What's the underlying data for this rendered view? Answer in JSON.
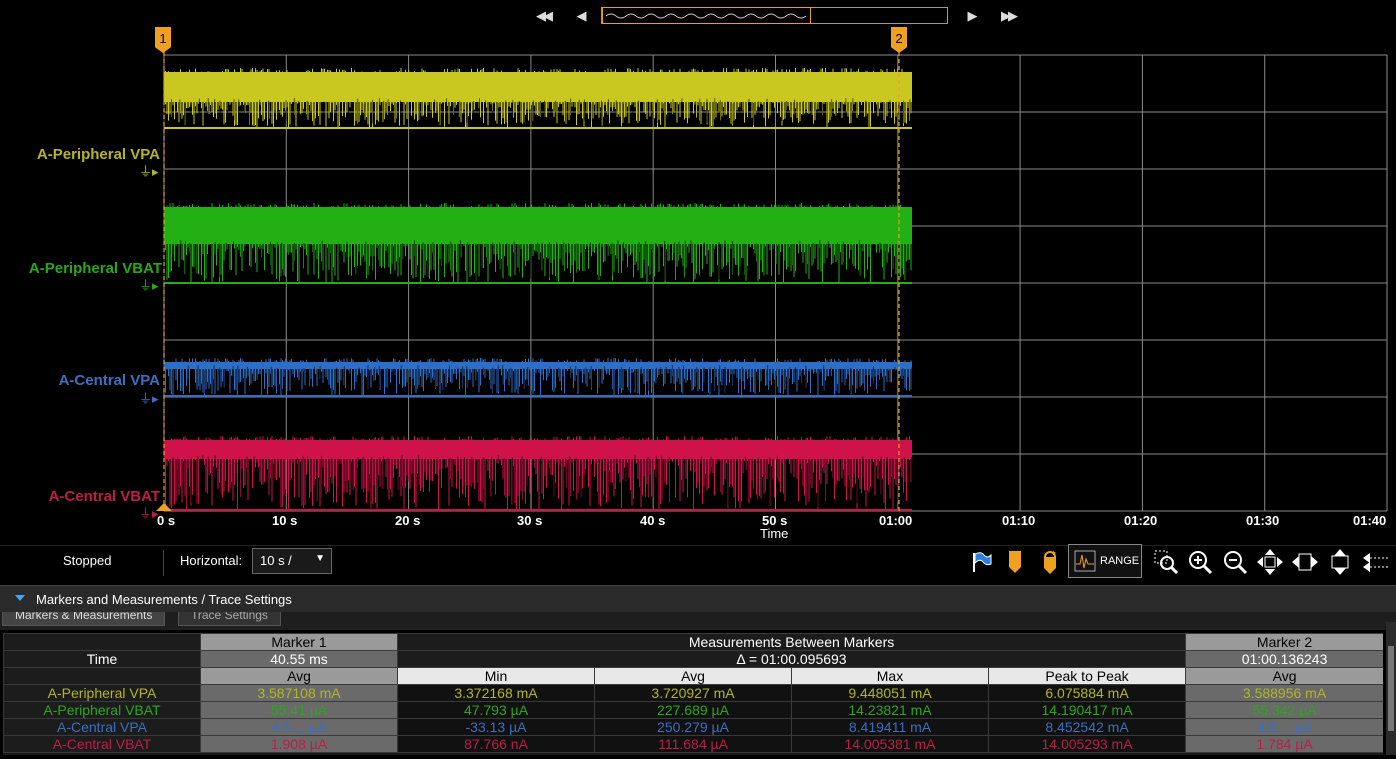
{
  "colors": {
    "peripheral_vpa": "#c8c820",
    "peripheral_vbat": "#22b014",
    "central_vpa": "#2d6ec8",
    "central_vbat": "#d0124a",
    "marker": "#f0a020",
    "grid": "#8a8a8a"
  },
  "traces": [
    {
      "label": "A-Peripheral VPA",
      "color": "#b4b428"
    },
    {
      "label": "A-Peripheral VBAT",
      "color": "#2aa818"
    },
    {
      "label": "A-Central VPA",
      "color": "#3a70c0"
    },
    {
      "label": "A-Central VBAT",
      "color": "#c01c48"
    }
  ],
  "markers": {
    "m1": "1",
    "m2": "2"
  },
  "time_axis": {
    "ticks": [
      "0 s",
      "10 s",
      "20 s",
      "30 s",
      "40 s",
      "50 s",
      "01:00",
      "01:10",
      "01:20",
      "01:30",
      "01:40"
    ],
    "label": "Time"
  },
  "toolbar": {
    "status": "Stopped",
    "horizontal_label": "Horizontal:",
    "horizontal_value": "10 s /",
    "range_label": "RANGE"
  },
  "panel": {
    "title": "Markers and Measurements / Trace Settings",
    "tabs": [
      "Markers & Measurements",
      "Trace Settings"
    ]
  },
  "table": {
    "marker1_header": "Marker 1",
    "between_header": "Measurements Between Markers",
    "marker2_header": "Marker 2",
    "time_label": "Time",
    "marker1_time": "40.55 ms",
    "delta": "Δ = 01:00.095693",
    "marker2_time": "01:00.136243",
    "col_avg": "Avg",
    "col_min": "Min",
    "col_max": "Max",
    "col_p2p": "Peak to Peak",
    "rows": [
      {
        "name": "A-Peripheral VPA",
        "m1_avg": "3.587108 mA",
        "min": "3.372168 mA",
        "avg": "3.720927 mA",
        "max": "9.448051 mA",
        "p2p": "6.075884 mA",
        "m2_avg": "3.588956 mA"
      },
      {
        "name": "A-Peripheral VBAT",
        "m1_avg": "55.41 µA",
        "min": "47.793 µA",
        "avg": "227.689 µA",
        "max": "14.23821 mA",
        "p2p": "14.190417 mA",
        "m2_avg": "55.342 µA"
      },
      {
        "name": "A-Central VPA",
        "m1_avg": "4.5… µA",
        "min": "-33.13 µA",
        "avg": "250.279 µA",
        "max": "8.419411 mA",
        "p2p": "8.452542 mA",
        "m2_avg": "4.5… µA"
      },
      {
        "name": "A-Central VBAT",
        "m1_avg": "1.908 µA",
        "min": "87.766 nA",
        "avg": "111.684 µA",
        "max": "14.005381 mA",
        "p2p": "14.005293 mA",
        "m2_avg": "1.784 µA"
      }
    ]
  }
}
